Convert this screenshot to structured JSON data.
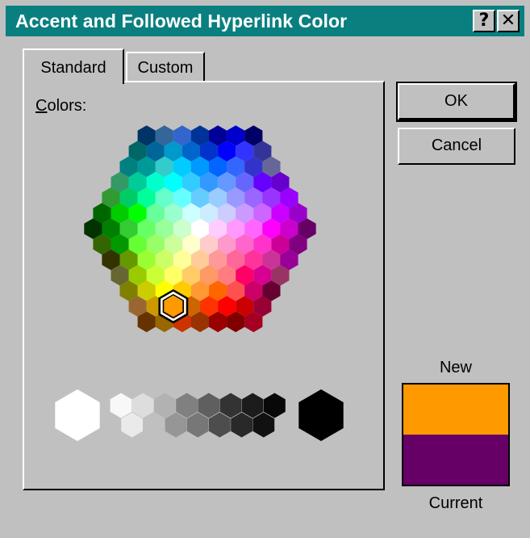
{
  "window": {
    "title": "Accent and Followed Hyperlink Color",
    "help_label": "?",
    "close_label": "✕"
  },
  "tabs": [
    {
      "label": "Standard",
      "selected": true
    },
    {
      "label": "Custom",
      "selected": false
    }
  ],
  "panel": {
    "colors_label_mnemonic": "C",
    "colors_label_rest": "olors:"
  },
  "buttons": {
    "ok": "OK",
    "cancel": "Cancel"
  },
  "preview": {
    "new_label": "New",
    "current_label": "Current",
    "new_color": "#ff9900",
    "current_color": "#660066"
  },
  "selected_color": "#ff9900",
  "palette": {
    "rows": [
      [
        "#003366",
        "#336699",
        "#3366cc",
        "#003399",
        "#000099",
        "#0000cc",
        "#000066"
      ],
      [
        "#006666",
        "#006699",
        "#0099cc",
        "#0066cc",
        "#0033cc",
        "#0000ff",
        "#3333ff",
        "#333399"
      ],
      [
        "#008080",
        "#009999",
        "#33cccc",
        "#00ccff",
        "#0099ff",
        "#0066ff",
        "#3366ff",
        "#3333cc",
        "#666699"
      ],
      [
        "#339966",
        "#00cc99",
        "#00ffcc",
        "#00ffff",
        "#33ccff",
        "#3399ff",
        "#6699ff",
        "#6666ff",
        "#6600ff",
        "#6600cc"
      ],
      [
        "#339933",
        "#00cc66",
        "#00ff99",
        "#66ffcc",
        "#66ffff",
        "#66ccff",
        "#99ccff",
        "#9999ff",
        "#9966ff",
        "#9933ff",
        "#9900ff"
      ],
      [
        "#006600",
        "#00cc00",
        "#00ff00",
        "#66ff99",
        "#99ffcc",
        "#ccffff",
        "#ccecff",
        "#ccccff",
        "#cc99ff",
        "#cc66ff",
        "#cc00ff",
        "#9900cc"
      ],
      [
        "#003300",
        "#008000",
        "#33cc33",
        "#66ff66",
        "#99ff99",
        "#ccffcc",
        "#ffffff",
        "#ffccff",
        "#ff99ff",
        "#ff66ff",
        "#ff00ff",
        "#cc00cc",
        "#660066"
      ],
      [
        "#336600",
        "#009900",
        "#66ff33",
        "#99ff66",
        "#ccff99",
        "#ffffcc",
        "#ffcccc",
        "#ff99cc",
        "#ff66cc",
        "#ff33cc",
        "#cc0099",
        "#800080"
      ],
      [
        "#333300",
        "#669900",
        "#99ff33",
        "#ccff66",
        "#ffff99",
        "#ffcc99",
        "#ff9999",
        "#ff6699",
        "#ff3399",
        "#cc3399",
        "#990099"
      ],
      [
        "#666633",
        "#99cc00",
        "#ccff33",
        "#ffff66",
        "#ffcc66",
        "#ff9966",
        "#ff7c80",
        "#ff0066",
        "#d60093",
        "#993366"
      ],
      [
        "#808000",
        "#cccc00",
        "#ffff00",
        "#ffcc00",
        "#ff9933",
        "#ff6600",
        "#ff5050",
        "#cc0066",
        "#660033"
      ],
      [
        "#996633",
        "#cc9900",
        "#ff9900",
        "#cc6600",
        "#ff3300",
        "#ff0000",
        "#cc0000",
        "#990033"
      ],
      [
        "#663300",
        "#996600",
        "#cc3300",
        "#993300",
        "#990000",
        "#800000",
        "#a50021"
      ]
    ],
    "grays_large_left": "#ffffff",
    "grays_top": [
      "#f8f8f8",
      "#dddddd",
      "#b2b2b2",
      "#808080",
      "#5f5f5f",
      "#333333",
      "#1c1c1c",
      "#080808"
    ],
    "grays_bottom": [
      "#eaeaea",
      "#c0c0c0",
      "#969696",
      "#777777",
      "#4d4d4d",
      "#292929",
      "#111111"
    ],
    "grays_large_right": "#000000"
  }
}
